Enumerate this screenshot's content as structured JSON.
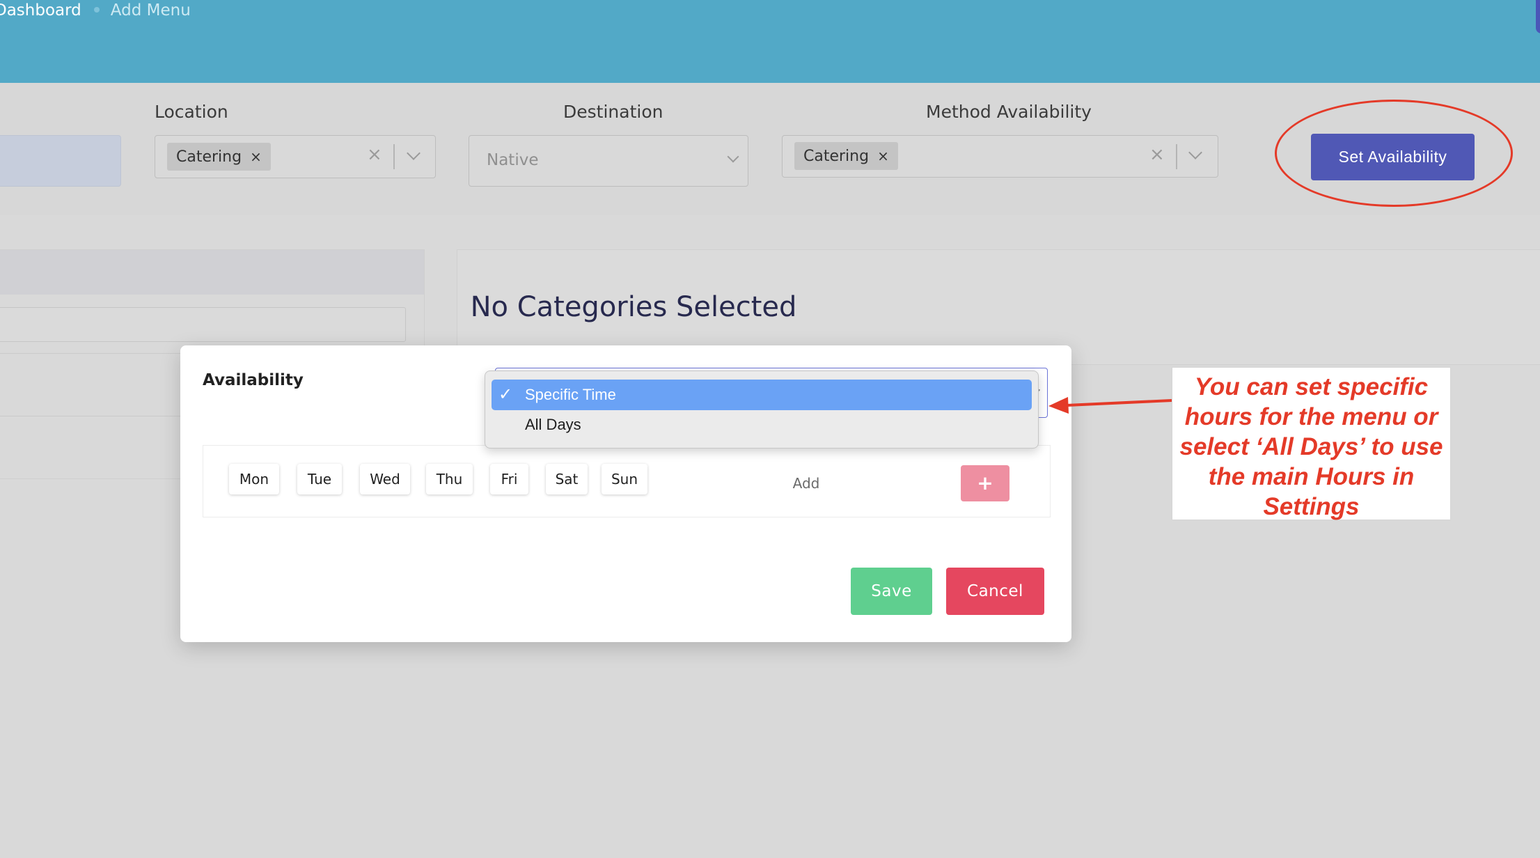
{
  "breadcrumb": {
    "items": [
      "Dashboard",
      "Add Menu"
    ]
  },
  "filters": {
    "location": {
      "label": "Location",
      "chip": "Catering",
      "chip_remove": "×",
      "clear": "×"
    },
    "destination": {
      "label": "Destination",
      "placeholder": "Native"
    },
    "method_availability": {
      "label": "Method Availability",
      "chip": "Catering",
      "chip_remove": "×",
      "clear": "×"
    },
    "set_availability_label": "Set Availability"
  },
  "main": {
    "no_categories": "No Categories Selected"
  },
  "modal": {
    "title": "Availability",
    "days": [
      "Mon",
      "Tue",
      "Wed",
      "Thu",
      "Fri",
      "Sat",
      "Sun"
    ],
    "add_label": "Add",
    "plus_label": "+",
    "save_label": "Save",
    "cancel_label": "Cancel"
  },
  "dropdown": {
    "options": [
      "Specific Time",
      "All Days"
    ],
    "selected_index": 0,
    "check": "✓"
  },
  "annotation": {
    "text": "You can set specific hours for the menu or select ‘All Days’ to use the main Hours in Settings",
    "color": "#e43a28"
  },
  "colors": {
    "header": "#52a9c7",
    "primary": "#5058b5",
    "save": "#5fcf8f",
    "cancel": "#e5475f",
    "dropdown_highlight": "#6aa2f5"
  }
}
